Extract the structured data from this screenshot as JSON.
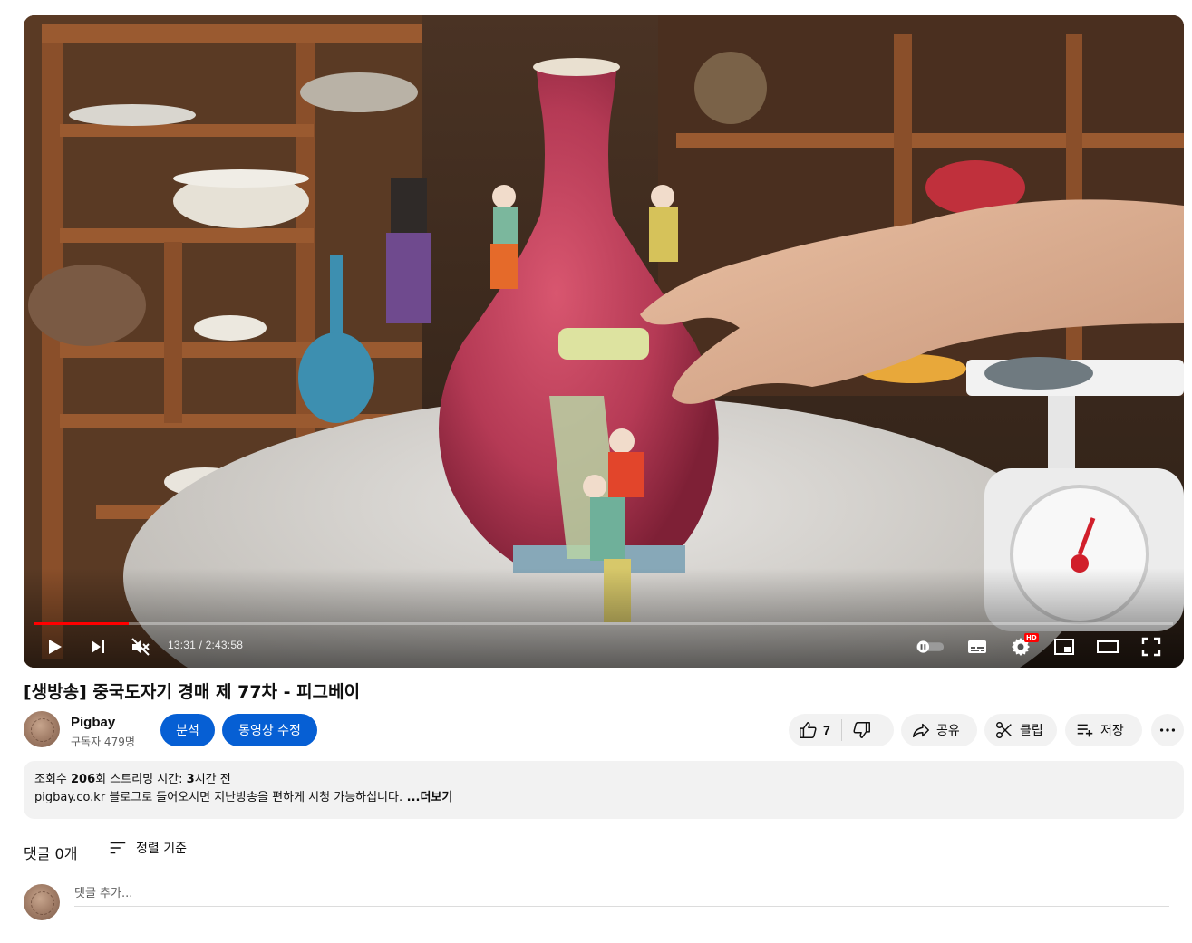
{
  "player": {
    "time_current": "13:31",
    "time_total": "2:43:58",
    "time_separator": " / ",
    "progress_fraction": 0.0825,
    "hd_badge": "HD",
    "accent_color": "#ff0000"
  },
  "video": {
    "title": "[생방송] 중국도자기 경매 제 77차 - 피그베이"
  },
  "channel": {
    "name": "Pigbay",
    "subscribers": "구독자 479명"
  },
  "buttons": {
    "analytics": "분석",
    "edit_video": "동영상 수정",
    "like_count": "7",
    "share": "공유",
    "clip": "클립",
    "save": "저장",
    "brand_color": "#065fd4"
  },
  "description": {
    "views_prefix": "조회수 ",
    "views_number": "206",
    "views_suffix": "회  스트리밍 시간: ",
    "time_number": "3",
    "time_suffix": "시간 전",
    "text": "pigbay.co.kr 블로그로 들어오시면 지난방송을 편하게 시청 가능하십니다.",
    "more": " ...더보기"
  },
  "comments": {
    "count_label": "댓글 0개",
    "sort_label": "정렬 기준",
    "placeholder": "댓글 추가..."
  },
  "icons": {
    "play": "play-icon",
    "next": "next-icon",
    "mute": "mute-icon",
    "autoplay": "autoplay-toggle-icon",
    "subtitles": "subtitles-icon",
    "settings": "settings-icon",
    "miniplayer": "miniplayer-icon",
    "theater": "theater-icon",
    "fullscreen": "fullscreen-icon",
    "like": "thumbs-up-icon",
    "dislike": "thumbs-down-icon",
    "share": "share-icon",
    "clip": "scissors-icon",
    "save": "playlist-add-icon",
    "more": "more-horizontal-icon",
    "sort": "sort-icon"
  }
}
